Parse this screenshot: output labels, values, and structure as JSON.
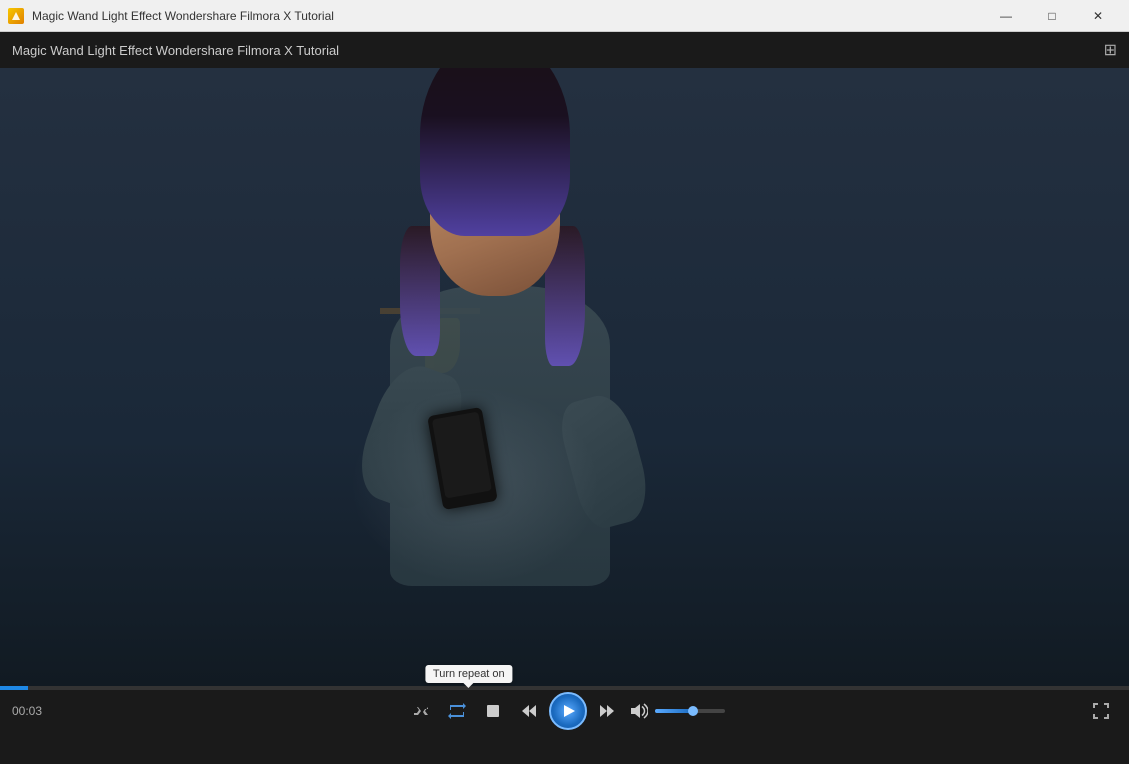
{
  "titleBar": {
    "appName": "Magic Wand Light Effect  Wondershare Filmora X Tutorial",
    "windowControls": {
      "minimize": "—",
      "maximize": "□",
      "close": "✕"
    }
  },
  "playerHeader": {
    "title": "Magic Wand Light Effect  Wondershare Filmora X Tutorial",
    "gridIconLabel": "⊞"
  },
  "controls": {
    "timeDisplay": "00:03",
    "tooltip": "Turn repeat on",
    "buttons": {
      "shuffle": "⇄",
      "repeat": "↺",
      "stop": "■",
      "rewind": "◀◀",
      "play": "▶",
      "fastForward": "▶▶",
      "volume": "🔊",
      "fullscreen": "⛶"
    }
  },
  "progress": {
    "fillPercent": 2.5
  },
  "volume": {
    "fillPercent": 55
  }
}
